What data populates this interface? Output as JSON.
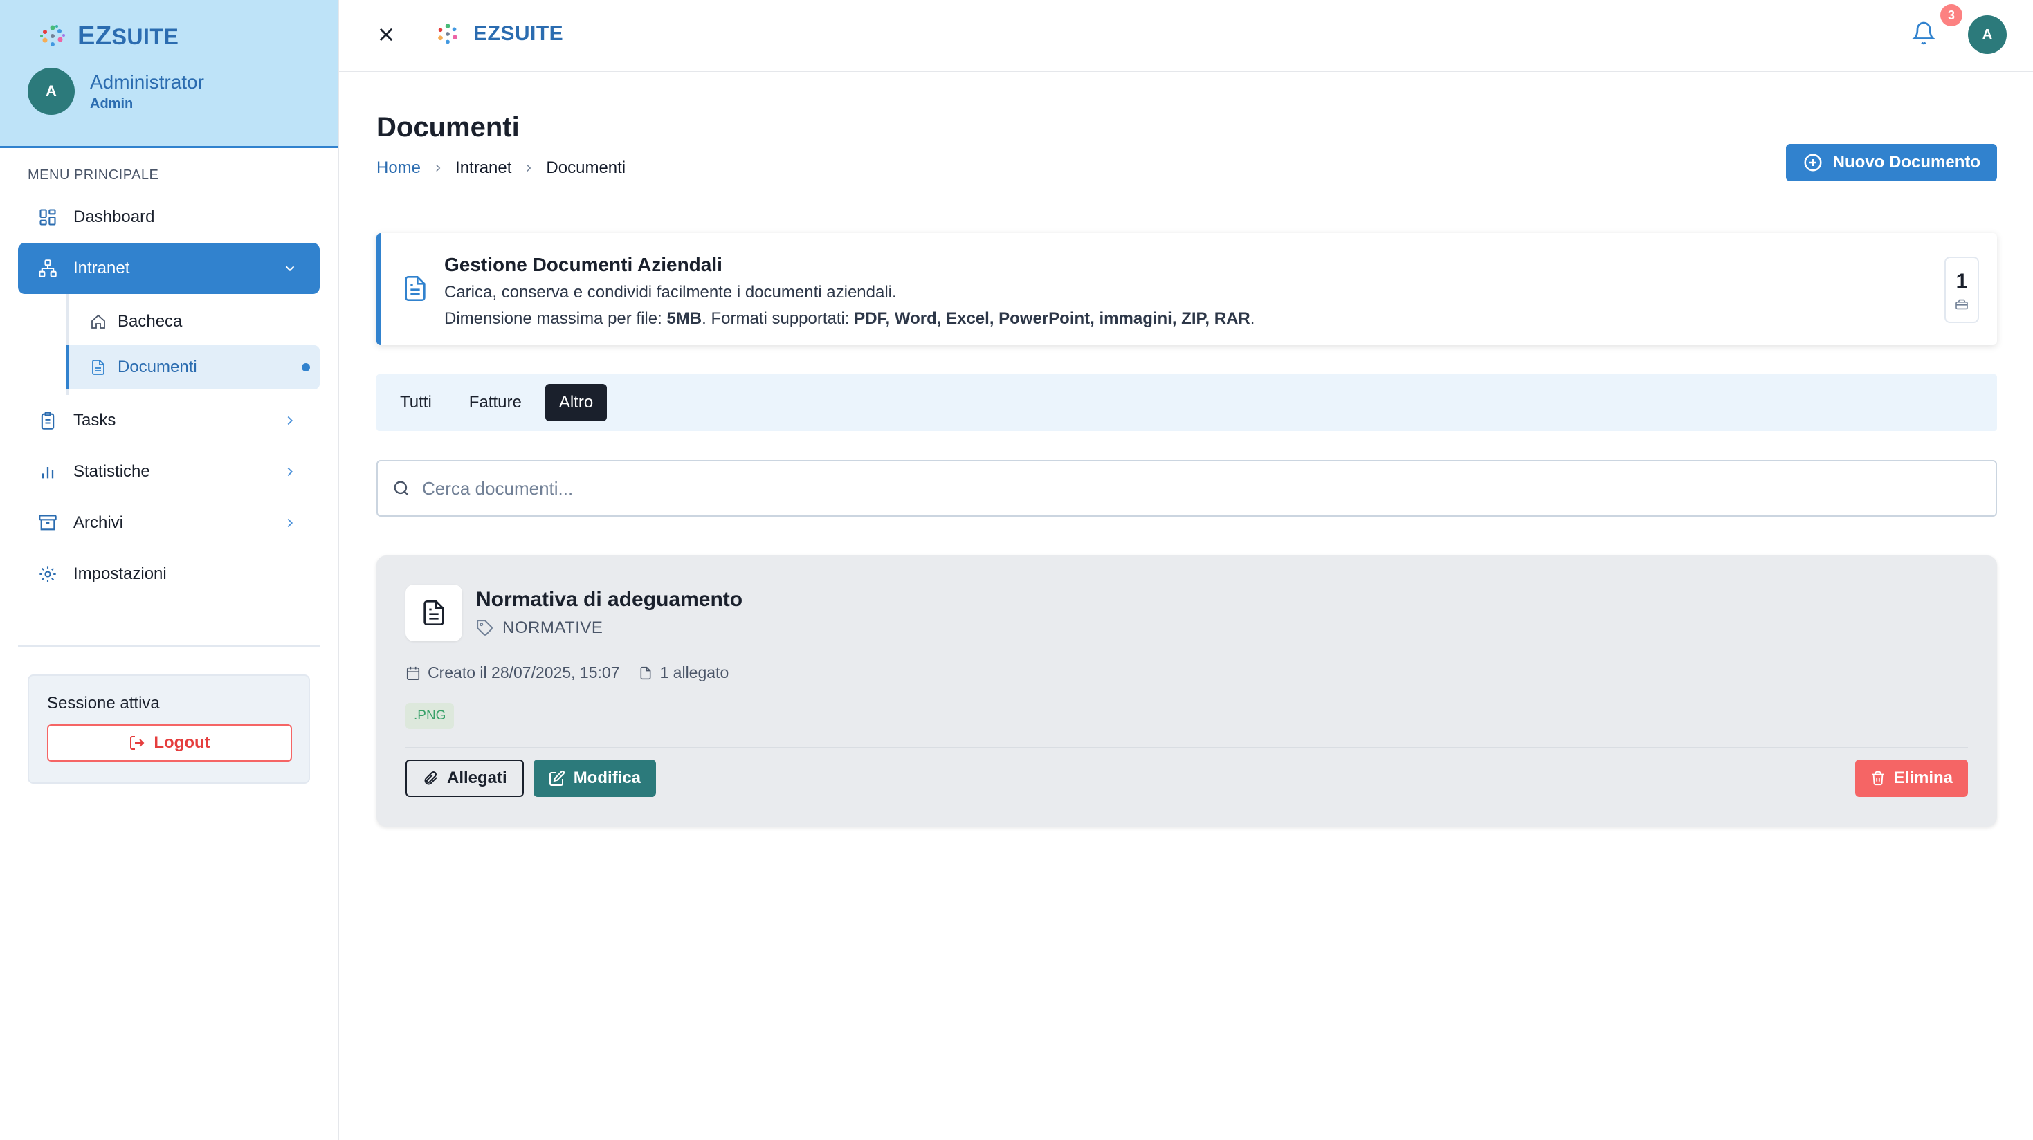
{
  "sidebar": {
    "brand": {
      "prefix": "EZ",
      "suffix": "SUITE"
    },
    "user": {
      "initial": "A",
      "name": "Administrator",
      "role": "Admin"
    },
    "menu_title": "MENU PRINCIPALE",
    "items": [
      {
        "label": "Dashboard",
        "icon": "grid-icon"
      },
      {
        "label": "Intranet",
        "icon": "network-icon",
        "active": true,
        "expanded": true
      },
      {
        "label": "Tasks",
        "icon": "clipboard-icon"
      },
      {
        "label": "Statistiche",
        "icon": "bar-chart-icon"
      },
      {
        "label": "Archivi",
        "icon": "archive-icon"
      },
      {
        "label": "Impostazioni",
        "icon": "gear-icon"
      }
    ],
    "subitems": [
      {
        "label": "Bacheca",
        "icon": "home-icon"
      },
      {
        "label": "Documenti",
        "icon": "file-icon",
        "active": true
      }
    ],
    "session_label": "Sessione attiva",
    "logout_label": "Logout"
  },
  "topbar": {
    "brand": "EZSUITE",
    "notification_count": "3",
    "avatar_initial": "A"
  },
  "main": {
    "title": "Documenti",
    "breadcrumb": [
      "Home",
      "Intranet",
      "Documenti"
    ],
    "new_button": "Nuovo Documento",
    "info": {
      "title": "Gestione Documenti Aziendali",
      "line1": "Carica, conserva e condividi facilmente i documenti aziendali.",
      "line2_prefix": "Dimensione massima per file: ",
      "line2_bold1": "5MB",
      "line2_mid": ". Formati supportati: ",
      "line2_bold2": "PDF, Word, Excel, PowerPoint, immagini, ZIP, RAR",
      "line2_suffix": ".",
      "count": "1"
    },
    "tabs": [
      {
        "label": "Tutti"
      },
      {
        "label": "Fatture"
      },
      {
        "label": "Altro",
        "active": true
      }
    ],
    "search_placeholder": "Cerca documenti...",
    "document": {
      "title": "Normativa di adeguamento",
      "category": "NORMATIVE",
      "created": "Creato il 28/07/2025, 15:07",
      "attachments": "1 allegato",
      "extension": ".PNG",
      "btn_attachments": "Allegati",
      "btn_edit": "Modifica",
      "btn_delete": "Elimina"
    }
  },
  "colors": {
    "primary": "#3182ce",
    "teal": "#2c7a7b",
    "danger": "#f56565",
    "sidebar_header": "#bee3f8"
  }
}
